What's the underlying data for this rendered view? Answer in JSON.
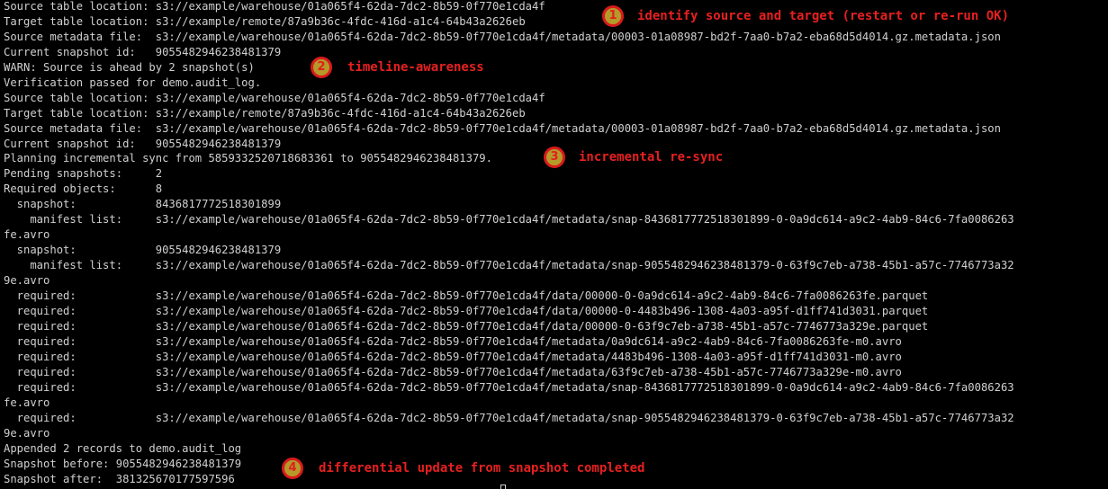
{
  "terminal": {
    "lines": [
      "Source table location: s3://example/warehouse/01a065f4-62da-7dc2-8b59-0f770e1cda4f",
      "Target table location: s3://example/remote/87a9b36c-4fdc-416d-a1c4-64b43a2626eb",
      "Source metadata file:  s3://example/warehouse/01a065f4-62da-7dc2-8b59-0f770e1cda4f/metadata/00003-01a08987-bd2f-7aa0-b7a2-eba68d5d4014.gz.metadata.json",
      "Current snapshot id:   9055482946238481379",
      "WARN: Source is ahead by 2 snapshot(s)",
      "Verification passed for demo.audit_log.",
      "Source table location: s3://example/warehouse/01a065f4-62da-7dc2-8b59-0f770e1cda4f",
      "Target table location: s3://example/remote/87a9b36c-4fdc-416d-a1c4-64b43a2626eb",
      "Source metadata file:  s3://example/warehouse/01a065f4-62da-7dc2-8b59-0f770e1cda4f/metadata/00003-01a08987-bd2f-7aa0-b7a2-eba68d5d4014.gz.metadata.json",
      "Current snapshot id:   9055482946238481379",
      "Planning incremental sync from 5859332520718683361 to 9055482946238481379.",
      "Pending snapshots:     2",
      "Required objects:      8",
      "  snapshot:            8436817772518301899",
      "    manifest list:     s3://example/warehouse/01a065f4-62da-7dc2-8b59-0f770e1cda4f/metadata/snap-8436817772518301899-0-0a9dc614-a9c2-4ab9-84c6-7fa0086263",
      "fe.avro",
      "  snapshot:            9055482946238481379",
      "    manifest list:     s3://example/warehouse/01a065f4-62da-7dc2-8b59-0f770e1cda4f/metadata/snap-9055482946238481379-0-63f9c7eb-a738-45b1-a57c-7746773a32",
      "9e.avro",
      "  required:            s3://example/warehouse/01a065f4-62da-7dc2-8b59-0f770e1cda4f/data/00000-0-0a9dc614-a9c2-4ab9-84c6-7fa0086263fe.parquet",
      "  required:            s3://example/warehouse/01a065f4-62da-7dc2-8b59-0f770e1cda4f/data/00000-0-4483b496-1308-4a03-a95f-d1ff741d3031.parquet",
      "  required:            s3://example/warehouse/01a065f4-62da-7dc2-8b59-0f770e1cda4f/data/00000-0-63f9c7eb-a738-45b1-a57c-7746773a329e.parquet",
      "  required:            s3://example/warehouse/01a065f4-62da-7dc2-8b59-0f770e1cda4f/metadata/0a9dc614-a9c2-4ab9-84c6-7fa0086263fe-m0.avro",
      "  required:            s3://example/warehouse/01a065f4-62da-7dc2-8b59-0f770e1cda4f/metadata/4483b496-1308-4a03-a95f-d1ff741d3031-m0.avro",
      "  required:            s3://example/warehouse/01a065f4-62da-7dc2-8b59-0f770e1cda4f/metadata/63f9c7eb-a738-45b1-a57c-7746773a329e-m0.avro",
      "  required:            s3://example/warehouse/01a065f4-62da-7dc2-8b59-0f770e1cda4f/metadata/snap-8436817772518301899-0-0a9dc614-a9c2-4ab9-84c6-7fa0086263",
      "fe.avro",
      "  required:            s3://example/warehouse/01a065f4-62da-7dc2-8b59-0f770e1cda4f/metadata/snap-9055482946238481379-0-63f9c7eb-a738-45b1-a57c-7746773a32",
      "9e.avro",
      "Appended 2 records to demo.audit_log",
      "Snapshot before: 9055482946238481379",
      "Snapshot after:  381325670177597596"
    ]
  },
  "annotations": [
    {
      "number": "1",
      "text": "identify source and target (restart or re-run OK)"
    },
    {
      "number": "2",
      "text": "timeline-awareness"
    },
    {
      "number": "3",
      "text": "incremental re-sync"
    },
    {
      "number": "4",
      "text": "differential update from snapshot completed"
    }
  ],
  "colors": {
    "background": "#000000",
    "terminal_text": "#d0d0d0",
    "annotation_text": "#e62020",
    "badge_fill": "#b59a2a",
    "badge_ring": "#d81b1b"
  }
}
